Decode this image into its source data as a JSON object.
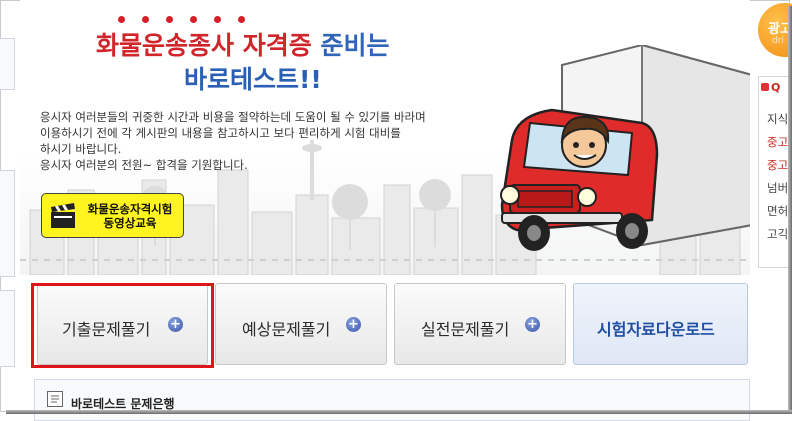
{
  "hero": {
    "title_red": "화물운송종사 자격증",
    "title_blue": "준비는",
    "title_line2": "바로테스트!!",
    "description": [
      "응시자 여러분들의 귀중한 시간과 비용을 절약하는데 도움이 될 수 있기를 바라며",
      "이용하시기 전에 각 게시판의 내용을 참고하시고 보다 편리하게 시험 대비를",
      "하시기 바랍니다.",
      "응시자 여러분의 전원~ 합격을 기원합니다."
    ],
    "video_button": [
      "화물운송자격시험",
      "동영상교육"
    ]
  },
  "tabs": [
    {
      "label": "기출문제풀기",
      "has_plus": true
    },
    {
      "label": "예상문제풀기",
      "has_plus": true
    },
    {
      "label": "실전문제풀기",
      "has_plus": true
    },
    {
      "label": "시험자료다운로드",
      "has_plus": false
    }
  ],
  "bank_panel": {
    "title": "바로테스트 문제은행"
  },
  "right_sidebar": {
    "ad_text": "광고",
    "ad_sub": "dri",
    "box_head": "Q",
    "items": [
      {
        "text": "지식",
        "color": "gray"
      },
      {
        "text": "중고",
        "color": "red"
      },
      {
        "text": "중고",
        "color": "red"
      },
      {
        "text": "넘버",
        "color": "gray"
      },
      {
        "text": "면허",
        "color": "gray"
      },
      {
        "text": "고긱",
        "color": "gray"
      }
    ]
  },
  "colors": {
    "title_red": "#d0262b",
    "title_blue": "#2f64b7",
    "highlight": "#e0141b",
    "video_button_bg": "#fff41f"
  }
}
